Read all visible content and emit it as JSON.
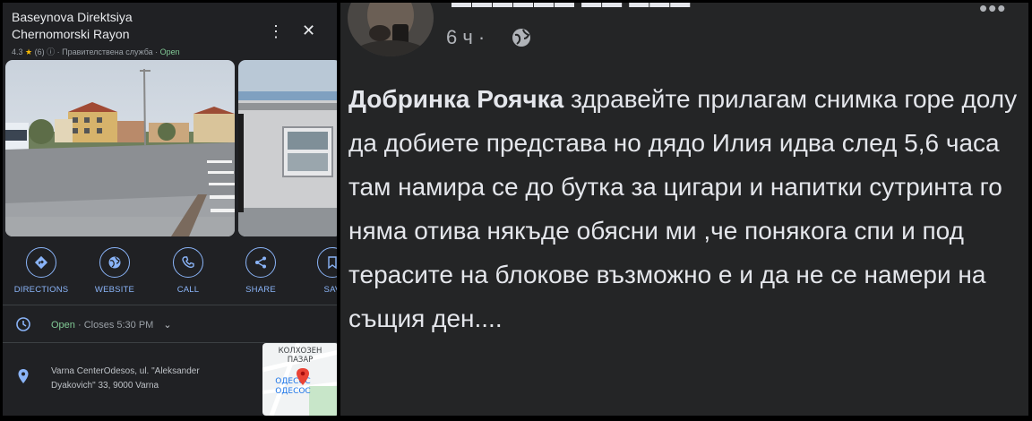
{
  "maps": {
    "title_line1": "Baseynova Direktsiya",
    "title_line2": "Chernomorski Rayon",
    "rating": "4.3",
    "reviews": "(6)",
    "category": "· Правителствена служба ·",
    "open_status": "Open",
    "actions": [
      {
        "label": "DIRECTIONS",
        "icon": "directions-icon"
      },
      {
        "label": "WEBSITE",
        "icon": "globe-icon"
      },
      {
        "label": "CALL",
        "icon": "phone-icon"
      },
      {
        "label": "SHARE",
        "icon": "share-icon"
      },
      {
        "label": "SAV",
        "icon": "bookmark-icon"
      }
    ],
    "hours_open": "Open",
    "hours_closes": "· Closes 5:30 PM",
    "address_line1": "Varna CenterOdesos, ul. \"Aleksander",
    "address_line2": "Dyakovich\" 33, 9000 Varna",
    "map_label_1": "КОЛХОЗЕН",
    "map_label_2": "ПАЗАР",
    "map_label_3": "ОДЕСОС",
    "map_label_4": "ОДЕСОС",
    "colors": {
      "accent": "#8ab4f8",
      "open": "#81c995",
      "bg": "#202124",
      "star": "#fbbc04"
    }
  },
  "post": {
    "time": "6 ч ·",
    "author": "Добринка Роячка",
    "text": " здравейте прилагам снимка горе долу да добиете представа но дядо Илия идва след 5,6 часа там намира се до бутка за цигари и напитки сутринта го няма отива някъде обясни ми ,че понякога спи и под терасите на блокове възможно е и да не се намери на същия ден....",
    "colors": {
      "bg": "#242526",
      "text": "#e4e6eb",
      "muted": "#b0b3b8"
    }
  }
}
